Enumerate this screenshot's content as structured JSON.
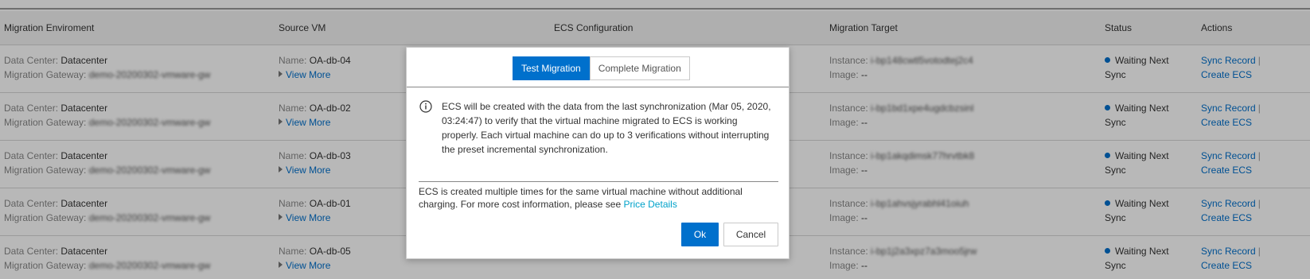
{
  "table": {
    "headers": {
      "env": "Migration Enviroment",
      "source": "Source VM",
      "ecs": "ECS Configuration",
      "target": "Migration Target",
      "status": "Status",
      "actions": "Actions"
    },
    "labels": {
      "data_center": "Data Center:",
      "gateway": "Migration Gateway:",
      "name": "Name:",
      "view_more": "View More",
      "instance": "Instance:",
      "image": "Image:",
      "sync_record": "Sync Record",
      "separator": "|",
      "create_ecs": "Create ECS"
    },
    "rows": [
      {
        "data_center": "Datacenter",
        "gateway": "demo-20200302-vmware-gw",
        "vm_name": "OA-db-04",
        "instance": "i-bp148cwtl5votodtej2c4",
        "image": "--",
        "status": "Waiting Next Sync"
      },
      {
        "data_center": "Datacenter",
        "gateway": "demo-20200302-vmware-gw",
        "vm_name": "OA-db-02",
        "instance": "i-bp1bd1xpe4ugdcbzsinl",
        "image": "--",
        "status": "Waiting Next Sync"
      },
      {
        "data_center": "Datacenter",
        "gateway": "demo-20200302-vmware-gw",
        "vm_name": "OA-db-03",
        "instance": "i-bp1akqdimsk77hrvtbk8",
        "image": "--",
        "status": "Waiting Next Sync"
      },
      {
        "data_center": "Datacenter",
        "gateway": "demo-20200302-vmware-gw",
        "vm_name": "OA-db-01",
        "instance": "i-bp1ahvsjyrabhl41oiuh",
        "image": "--",
        "status": "Waiting Next Sync"
      },
      {
        "data_center": "Datacenter",
        "gateway": "demo-20200302-vmware-gw",
        "vm_name": "OA-db-05",
        "instance": "i-bp1j2a3xpz7a3moo5jrw",
        "image": "--",
        "status": "Waiting Next Sync"
      }
    ]
  },
  "dialog": {
    "tabs": [
      "Test Migration",
      "Complete Migration"
    ],
    "active_tab": "Test Migration",
    "info_text": "ECS will be created with the data from the last synchronization (Mar 05, 2020, 03:24:47) to verify that the virtual machine migrated to ECS is working properly. Each virtual machine can do up to 3 verifications without interrupting the preset incremental synchronization.",
    "note_text": "ECS is created multiple times for the same virtual machine without additional charging. For more cost information, please see",
    "note_link": "Price Details",
    "ok_label": "Ok",
    "cancel_label": "Cancel"
  },
  "colors": {
    "accent": "#0070cc",
    "link": "#0070cc",
    "note_link": "#00a2ca",
    "overlay": "rgba(0,0,0,0.28)"
  }
}
